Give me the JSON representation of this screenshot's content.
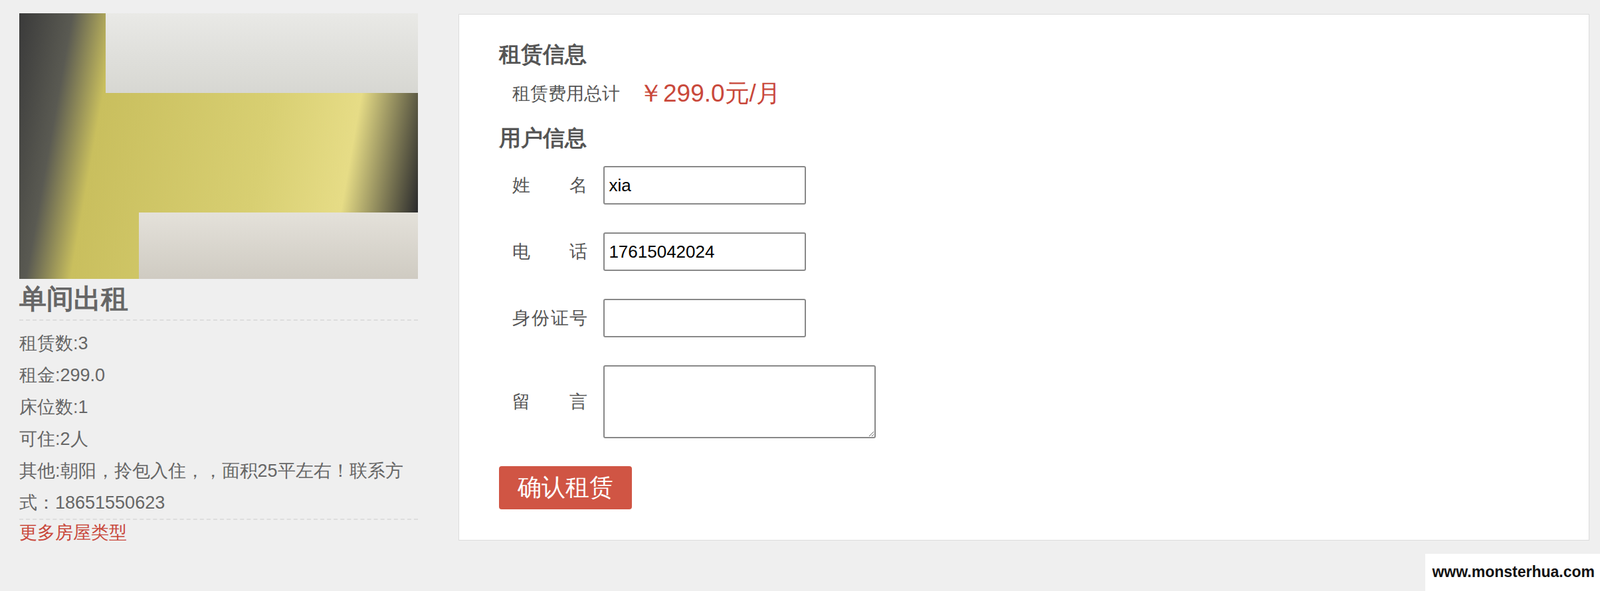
{
  "listing": {
    "title": "单间出租",
    "details": [
      "租赁数:3",
      "租金:299.0",
      "床位数:1",
      "可住:2人",
      "其他:朝阳，拎包入住，，面积25平左右！联系方式：18651550623"
    ],
    "more_link": "更多房屋类型"
  },
  "rent_section": {
    "heading": "租赁信息",
    "total_label": "租赁费用总计",
    "total_value": "￥299.0元/月"
  },
  "user_section": {
    "heading": "用户信息",
    "fields": [
      {
        "label": "姓名",
        "value": "xia",
        "kind": "input"
      },
      {
        "label": "电话",
        "value": "17615042024",
        "kind": "input"
      },
      {
        "label": "身份证号",
        "value": "",
        "kind": "input"
      },
      {
        "label": "留言",
        "value": "",
        "kind": "textarea"
      }
    ]
  },
  "submit": "确认租赁",
  "watermark": "www.monsterhua.com"
}
